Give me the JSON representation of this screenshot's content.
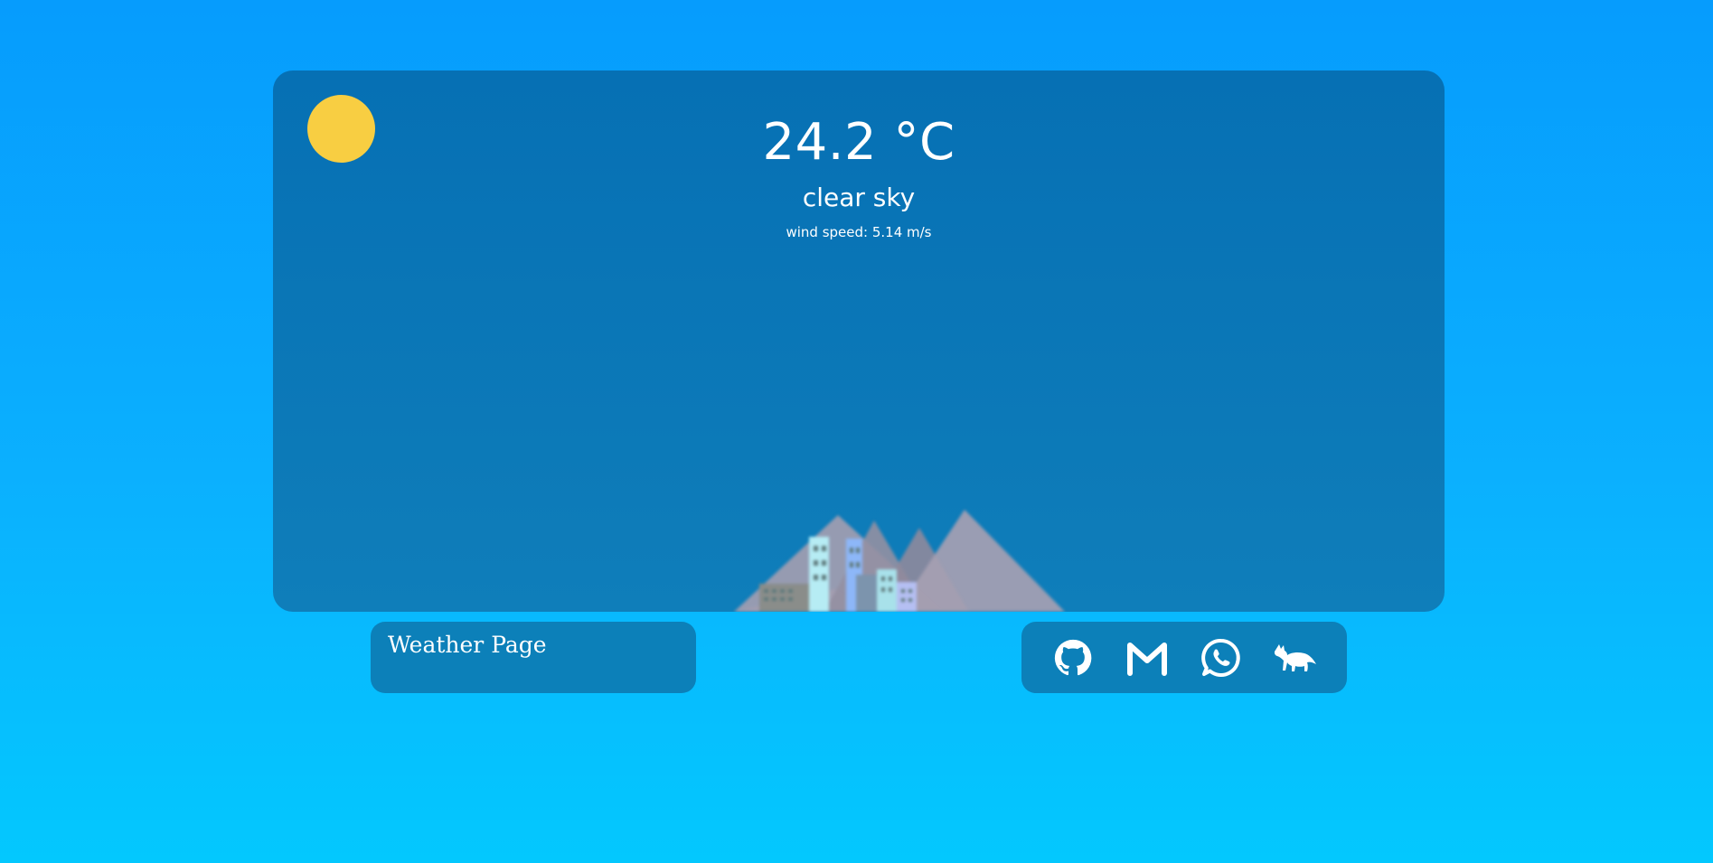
{
  "weather": {
    "temperature": "24.2 °C",
    "description": "clear sky",
    "wind": "wind speed: 5.14 m/s",
    "icon": "sun-icon"
  },
  "footer": {
    "title": "Weather Page",
    "links": [
      {
        "name": "github",
        "icon": "github-icon"
      },
      {
        "name": "gmail",
        "icon": "gmail-icon"
      },
      {
        "name": "whatsapp",
        "icon": "whatsapp-icon"
      },
      {
        "name": "fox",
        "icon": "fox-icon"
      }
    ]
  },
  "colors": {
    "background_top": "#069cfd",
    "background_bottom": "#03c8fe",
    "card": "#0670b4",
    "panel": "#0c80b9",
    "sun": "#f8ce42"
  }
}
